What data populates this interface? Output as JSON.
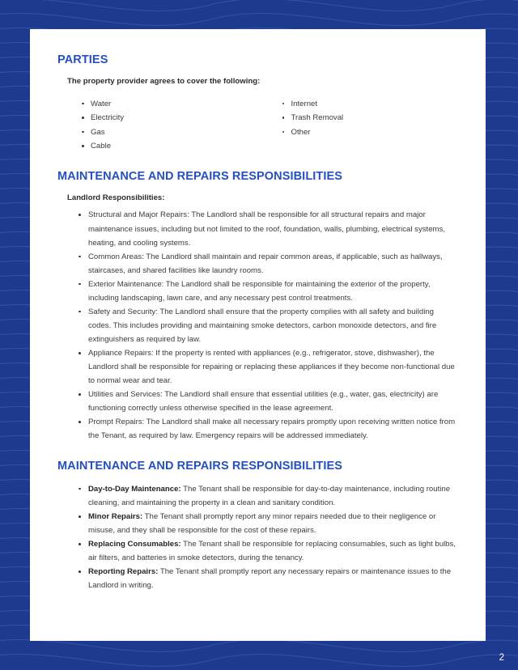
{
  "document": {
    "page_number": "2",
    "background_color": "#1e3a8f",
    "sheet_color": "#ffffff",
    "heading_color": "#2650bd",
    "body_text_color": "#3b3b42"
  },
  "sections": [
    {
      "id": "parties",
      "heading": "PARTIES",
      "intro": "The property provider agrees to cover the following:",
      "utilities_column_left": [
        "Water",
        "Electricity",
        "Gas",
        "Cable"
      ],
      "utilities_column_right": [
        "Internet",
        "Trash Removal",
        "Other"
      ]
    },
    {
      "id": "landlord-responsibilities",
      "heading": "MAINTENANCE AND REPAIRS RESPONSIBILITIES",
      "sub_label": "Landlord Responsibilities:",
      "items": [
        "Structural and Major Repairs: The Landlord shall be responsible for all structural repairs and major maintenance issues, including but not limited to the roof, foundation, walls, plumbing, electrical systems, heating, and cooling systems.",
        "Common Areas: The Landlord shall maintain and repair common areas, if applicable, such as hallways, staircases, and shared facilities like laundry rooms.",
        "Exterior Maintenance: The Landlord shall be responsible for maintaining the exterior of the property, including landscaping, lawn care, and any necessary pest control treatments.",
        "Safety and Security: The Landlord shall ensure that the property complies with all safety and building codes. This includes providing and maintaining smoke detectors, carbon monoxide detectors, and fire extinguishers as required by law.",
        "Appliance Repairs: If the property is rented with appliances (e.g., refrigerator, stove, dishwasher), the Landlord shall be responsible for repairing or replacing these appliances if they become non-functional due to normal wear and tear.",
        "Utilities and Services: The Landlord shall ensure that essential utilities (e.g., water, gas, electricity) are functioning correctly unless otherwise specified in the lease agreement.",
        "Prompt Repairs: The Landlord shall make all necessary repairs promptly upon receiving written notice from the Tenant, as required by law. Emergency repairs will be addressed immediately."
      ]
    },
    {
      "id": "tenant-responsibilities",
      "heading": "MAINTENANCE AND REPAIRS RESPONSIBILITIES",
      "items": [
        {
          "term": "Day-to-Day Maintenance:",
          "text": " The Tenant shall be responsible for day-to-day maintenance, including routine cleaning, and maintaining the property in a clean and sanitary condition."
        },
        {
          "term": "Minor Repairs:",
          "text": " The Tenant shall promptly report any minor repairs needed due to their negligence or misuse, and they shall be responsible for the cost of these repairs."
        },
        {
          "term": "Replacing Consumables:",
          "text": " The Tenant shall be responsible for replacing consumables, such as light bulbs, air filters, and batteries in smoke detectors, during the tenancy."
        },
        {
          "term": "Reporting Repairs:",
          "text": " The Tenant shall promptly report any necessary repairs or maintenance issues to the Landlord in writing."
        }
      ]
    }
  ]
}
